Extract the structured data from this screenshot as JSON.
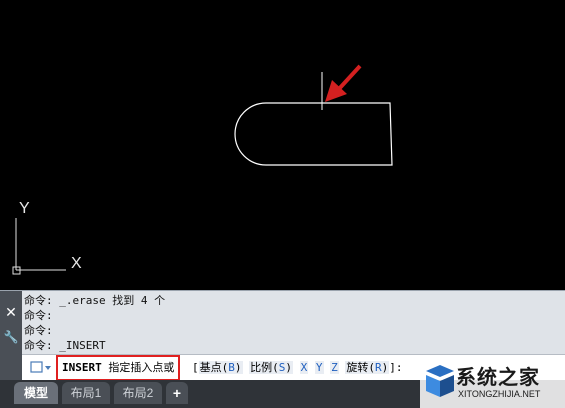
{
  "axis": {
    "x_label": "X",
    "y_label": "Y"
  },
  "command_history": [
    "命令: _.erase 找到 4 个",
    "命令:",
    "命令:",
    "命令: _INSERT"
  ],
  "prompt": {
    "command": "INSERT",
    "text": "指定插入点或"
  },
  "options": {
    "open_bracket": "[",
    "basepoint_label": "基点(",
    "basepoint_key": "B",
    "basepoint_close": ")",
    "scale_label": "比例(",
    "scale_key": "S",
    "scale_close": ")",
    "x": "X",
    "y": "Y",
    "z": "Z",
    "rotate_label": "旋转(",
    "rotate_key": "R",
    "rotate_close": ")",
    "close_bracket": "]:"
  },
  "sidebar": {
    "close_icon": "✕",
    "settings_icon": "🔧"
  },
  "tabs": [
    {
      "label": "模型"
    },
    {
      "label": "布局1"
    },
    {
      "label": "布局2"
    },
    {
      "label": "+"
    }
  ],
  "watermark": {
    "title": "系统之家",
    "url": "XITONGZHIJIA.NET"
  },
  "colors": {
    "canvas": "#000000",
    "highlight": "#e02020",
    "option_key": "#1f5fbf"
  }
}
